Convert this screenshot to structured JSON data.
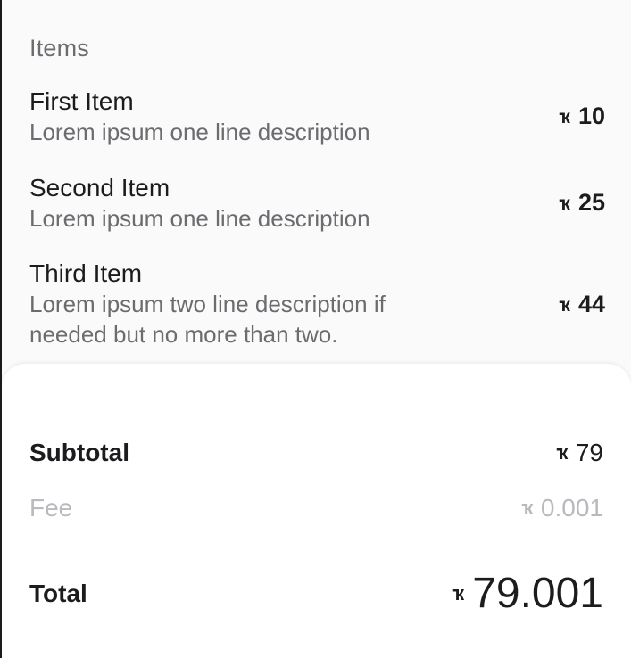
{
  "items_section": {
    "title": "Items",
    "currency_symbol": "ҡ",
    "items": [
      {
        "name": "First Item",
        "description": "Lorem ipsum one line description",
        "price": "10"
      },
      {
        "name": "Second Item",
        "description": "Lorem ipsum one line description",
        "price": "25"
      },
      {
        "name": "Third Item",
        "description": "Lorem ipsum two line description if needed but no more than two.",
        "price": "44"
      }
    ]
  },
  "summary": {
    "currency_symbol": "ҡ",
    "subtotal": {
      "label": "Subtotal",
      "value": "79"
    },
    "fee": {
      "label": "Fee",
      "value": "0.001"
    },
    "total": {
      "label": "Total",
      "value": "79.001"
    }
  },
  "colors": {
    "primary_text": "#1c1c1e",
    "secondary_text": "#6b6b70",
    "muted_text": "#b9b9be"
  }
}
